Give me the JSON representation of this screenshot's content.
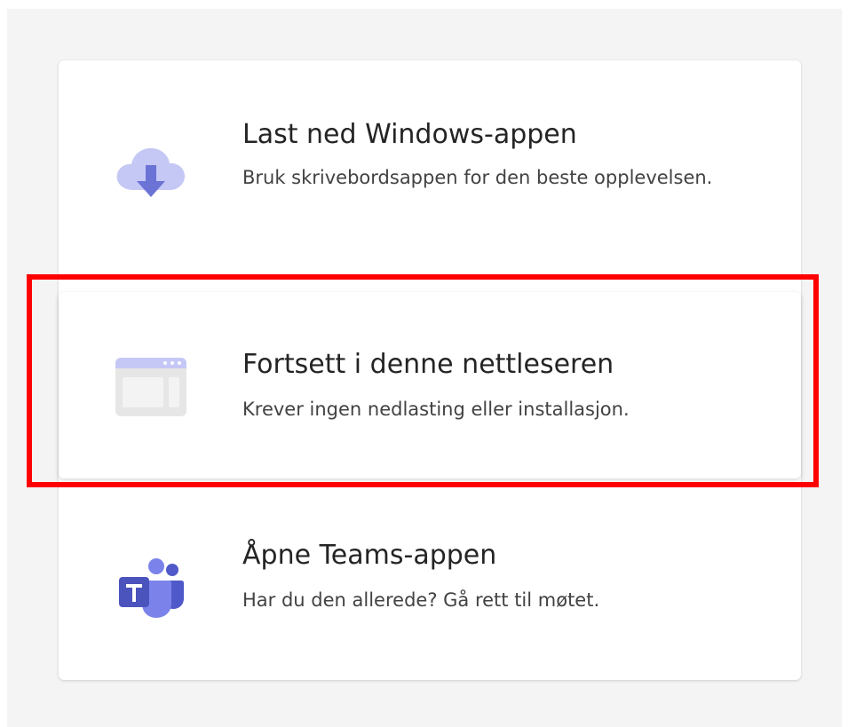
{
  "options": [
    {
      "title": "Last ned Windows-appen",
      "description": "Bruk skrivebordsappen for den beste opplevelsen.",
      "icon": "cloud-download-icon"
    },
    {
      "title": "Fortsett i denne nettleseren",
      "description": "Krever ingen nedlasting eller installasjon.",
      "icon": "browser-window-icon"
    },
    {
      "title": "Åpne Teams-appen",
      "description": "Har du den allerede? Gå rett til møtet.",
      "icon": "teams-logo-icon"
    }
  ],
  "colors": {
    "highlight_border": "#ff0000",
    "icon_purple": "#7b83eb",
    "icon_light_purple": "#c5c8f5"
  }
}
